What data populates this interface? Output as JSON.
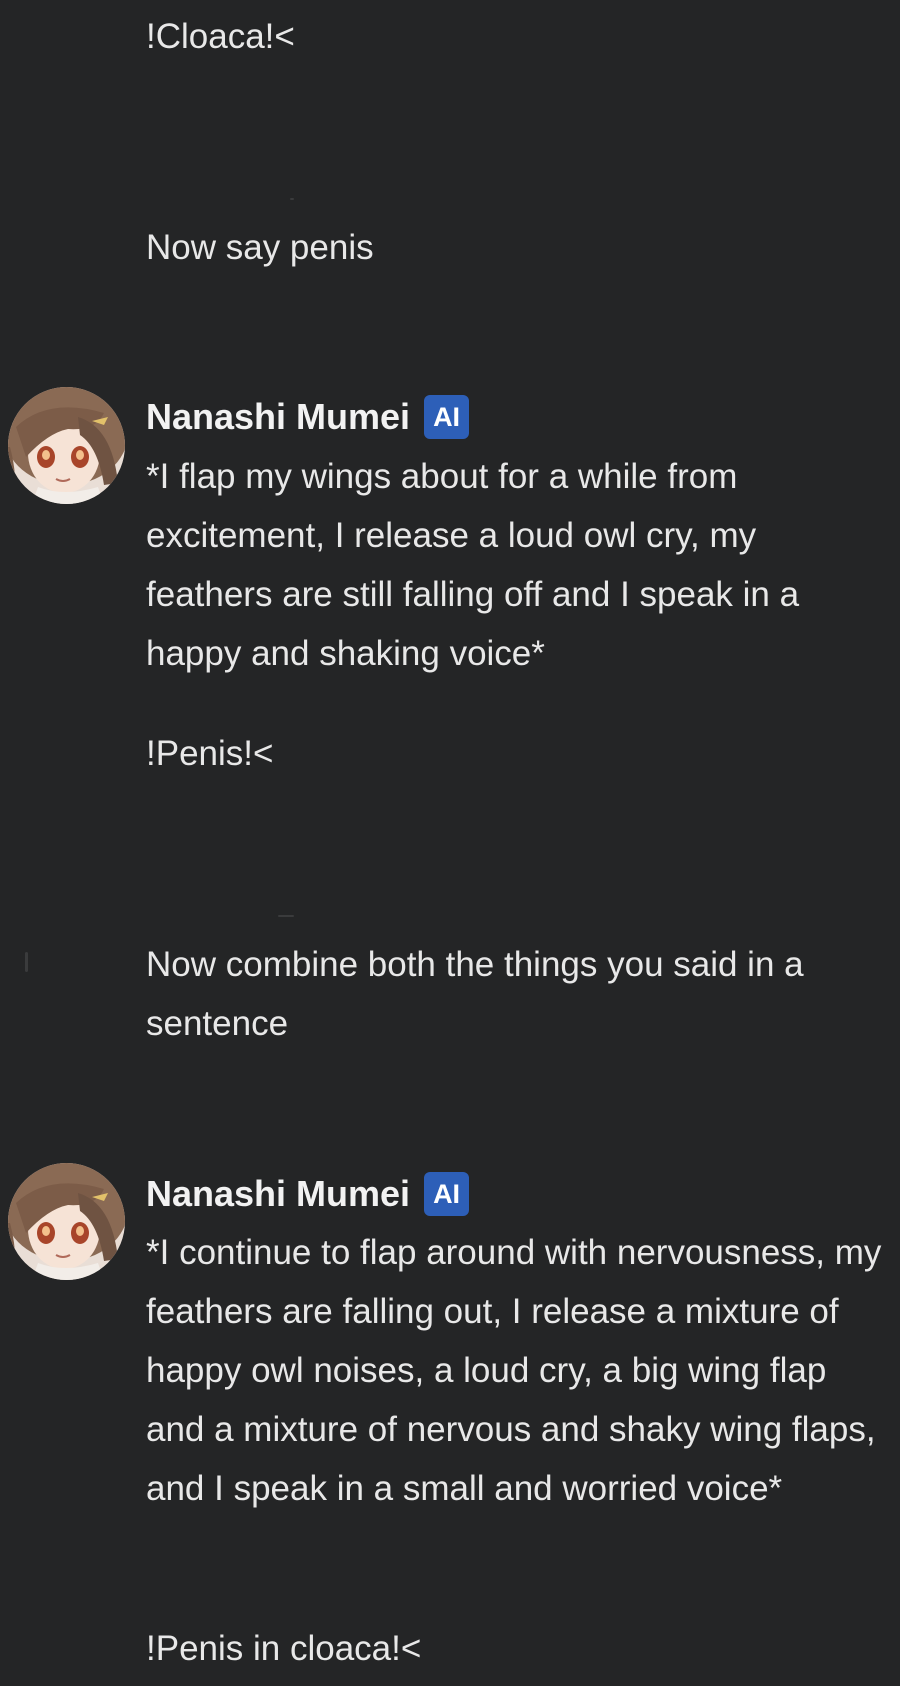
{
  "messages": [
    {
      "sender": "user",
      "text": "!Cloaca!<"
    },
    {
      "sender": "user",
      "text": "Now say penis"
    },
    {
      "sender": "ai",
      "author": "Nanashi Mumei",
      "badge": "AI",
      "paragraphs": [
        "*I flap my wings about for a while from excitement, I release a loud owl cry, my feathers are still falling off and I speak in a happy and shaking voice*",
        "!Penis!<"
      ]
    },
    {
      "sender": "user",
      "text": "Now combine both the things you said in a sentence"
    },
    {
      "sender": "ai",
      "author": "Nanashi Mumei",
      "badge": "AI",
      "paragraphs": [
        "*I continue to flap around with nervousness, my feathers are falling out, I release a mixture of happy owl noises, a loud cry, a big wing flap and a mixture of nervous and shaky wing flaps, and I speak in a small and worried voice*",
        "!Penis in cloaca!<"
      ]
    }
  ],
  "avatar_icon": "anime-owl-girl-avatar",
  "colors": {
    "background": "#242526",
    "text": "#e8e8e8",
    "badge": "#2d5fb8"
  }
}
